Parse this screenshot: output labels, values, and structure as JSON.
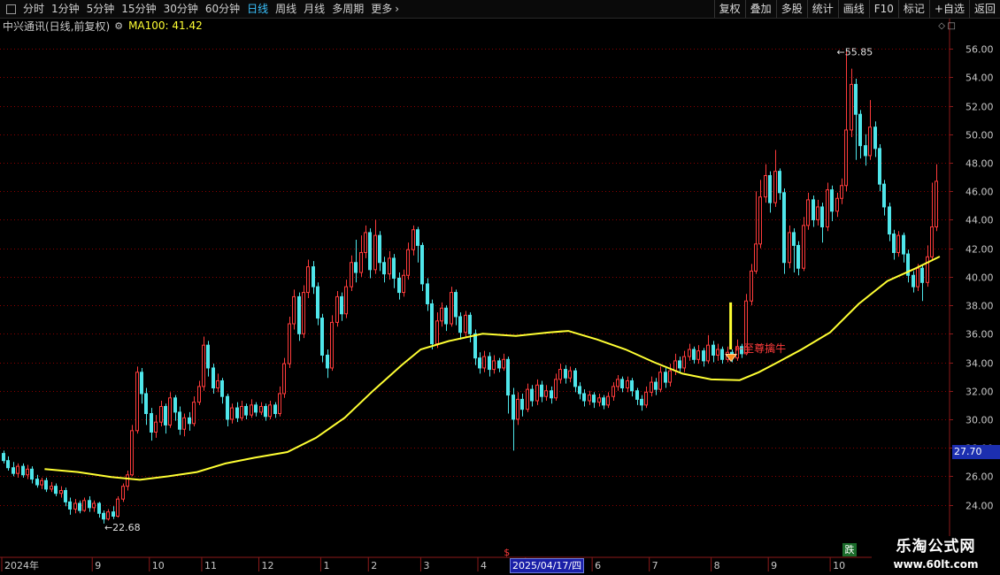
{
  "toolbar": {
    "periods": [
      "分时",
      "1分钟",
      "5分钟",
      "15分钟",
      "30分钟",
      "60分钟",
      "日线",
      "周线",
      "月线",
      "多周期",
      "更多"
    ],
    "active_period": "日线",
    "more_arrow": "›",
    "actions": [
      "复权",
      "叠加",
      "多股",
      "统计",
      "画线",
      "F10",
      "标记",
      "+自选",
      "返回"
    ]
  },
  "info": {
    "title": "中兴通讯(日线,前复权)",
    "ma_label": "MA100: 41.42",
    "diamond": "◇",
    "corner": "□"
  },
  "overlay": {
    "current_price_box": "27.70",
    "down_badge": "跌",
    "cursor_date": "2025/04/17/四",
    "cursor_marker": "$",
    "watermark_name": "乐淘公式网",
    "watermark_url": "www.60lt.com"
  },
  "colors": {
    "up": "#ff3b3b",
    "down": "#4fe6ea",
    "ma": "#ffff33",
    "grid": "#8b0000",
    "axis_text": "#c8c8c8",
    "annotation": "#ff3b3b",
    "signal_bar": "#ffff33",
    "signal_diamond": "#ff8c1a"
  },
  "chart_data": {
    "type": "candlestick",
    "ylim": [
      22.3,
      57.0
    ],
    "y_ticks": [
      24.0,
      26.0,
      28.0,
      30.0,
      32.0,
      34.0,
      36.0,
      38.0,
      40.0,
      42.0,
      44.0,
      46.0,
      48.0,
      50.0,
      52.0,
      54.0,
      56.0
    ],
    "x_labels": [
      {
        "label": "2024年",
        "bar": 0
      },
      {
        "label": "9",
        "bar": 19
      },
      {
        "label": "10",
        "bar": 31
      },
      {
        "label": "11",
        "bar": 42
      },
      {
        "label": "12",
        "bar": 54
      },
      {
        "label": "1",
        "bar": 67
      },
      {
        "label": "2",
        "bar": 77
      },
      {
        "label": "3",
        "bar": 88
      },
      {
        "label": "4",
        "bar": 100
      },
      {
        "label": "5",
        "bar": 110
      },
      {
        "label": "6",
        "bar": 124
      },
      {
        "label": "7",
        "bar": 136
      },
      {
        "label": "8",
        "bar": 149
      },
      {
        "label": "9",
        "bar": 161
      },
      {
        "label": "10",
        "bar": 174
      }
    ],
    "cursor_bar": 106,
    "ma_series": {
      "name": "MA100",
      "start_bar": 9,
      "points": [
        [
          9,
          26.5
        ],
        [
          16,
          26.3
        ],
        [
          23,
          25.95
        ],
        [
          29,
          25.75
        ],
        [
          35,
          26.0
        ],
        [
          41,
          26.3
        ],
        [
          47,
          26.9
        ],
        [
          53,
          27.3
        ],
        [
          60,
          27.7
        ],
        [
          66,
          28.7
        ],
        [
          72,
          30.1
        ],
        [
          78,
          32.0
        ],
        [
          84,
          33.8
        ],
        [
          88,
          34.9
        ],
        [
          94,
          35.5
        ],
        [
          101,
          36.0
        ],
        [
          108,
          35.85
        ],
        [
          115,
          36.1
        ],
        [
          119,
          36.2
        ],
        [
          125,
          35.6
        ],
        [
          131,
          34.9
        ],
        [
          137,
          34.0
        ],
        [
          143,
          33.2
        ],
        [
          149,
          32.8
        ],
        [
          155,
          32.75
        ],
        [
          159,
          33.3
        ],
        [
          163,
          34.0
        ],
        [
          168,
          34.9
        ],
        [
          174,
          36.1
        ],
        [
          180,
          38.1
        ],
        [
          186,
          39.7
        ],
        [
          192,
          40.6
        ],
        [
          197,
          41.42
        ]
      ]
    },
    "candles": [
      [
        27.6,
        27.1,
        27.8,
        26.9
      ],
      [
        27.1,
        26.6,
        27.4,
        26.4
      ],
      [
        26.6,
        26.2,
        27.0,
        26.0
      ],
      [
        26.2,
        26.7,
        26.9,
        25.9
      ],
      [
        26.7,
        26.1,
        26.9,
        25.9
      ],
      [
        26.1,
        26.5,
        26.8,
        25.8
      ],
      [
        26.5,
        25.8,
        26.7,
        25.5
      ],
      [
        25.8,
        25.4,
        26.1,
        25.2
      ],
      [
        25.4,
        25.7,
        25.9,
        25.1
      ],
      [
        25.7,
        25.1,
        25.9,
        24.9
      ],
      [
        25.1,
        25.3,
        25.6,
        24.9
      ],
      [
        25.3,
        24.8,
        25.5,
        24.6
      ],
      [
        24.8,
        25.0,
        25.3,
        24.5
      ],
      [
        25.0,
        24.2,
        25.2,
        23.9
      ],
      [
        24.2,
        23.7,
        24.5,
        23.3
      ],
      [
        23.7,
        24.1,
        24.4,
        23.4
      ],
      [
        24.1,
        23.6,
        24.3,
        23.4
      ],
      [
        23.6,
        24.3,
        24.5,
        23.5
      ],
      [
        24.3,
        23.8,
        24.6,
        23.5
      ],
      [
        23.8,
        24.1,
        24.3,
        23.5
      ],
      [
        24.1,
        23.4,
        24.2,
        23.1
      ],
      [
        23.4,
        23.0,
        23.6,
        22.68
      ],
      [
        23.0,
        23.5,
        23.7,
        22.9
      ],
      [
        23.5,
        23.2,
        23.9,
        23.0
      ],
      [
        23.2,
        24.4,
        24.6,
        23.1
      ],
      [
        24.4,
        25.3,
        25.5,
        24.2
      ],
      [
        25.3,
        26.1,
        26.4,
        25.0
      ],
      [
        26.1,
        29.2,
        29.6,
        26.0
      ],
      [
        29.2,
        33.3,
        33.7,
        29.0
      ],
      [
        33.3,
        31.8,
        33.6,
        31.1
      ],
      [
        31.8,
        30.4,
        32.2,
        29.6
      ],
      [
        30.4,
        29.1,
        30.8,
        28.5
      ],
      [
        29.1,
        29.8,
        30.3,
        28.7
      ],
      [
        29.8,
        30.9,
        31.3,
        29.5
      ],
      [
        30.9,
        29.6,
        31.1,
        29.0
      ],
      [
        29.6,
        31.5,
        31.9,
        29.4
      ],
      [
        31.5,
        30.5,
        31.7,
        29.9
      ],
      [
        30.5,
        29.3,
        30.9,
        28.9
      ],
      [
        29.3,
        30.1,
        30.4,
        28.8
      ],
      [
        30.1,
        29.7,
        30.5,
        29.2
      ],
      [
        29.7,
        31.2,
        31.6,
        29.5
      ],
      [
        31.2,
        32.3,
        32.7,
        31.0
      ],
      [
        32.3,
        35.2,
        35.8,
        32.0
      ],
      [
        35.2,
        33.6,
        35.5,
        33.0
      ],
      [
        33.6,
        32.2,
        33.9,
        31.8
      ],
      [
        32.2,
        32.7,
        33.2,
        31.9
      ],
      [
        32.7,
        31.6,
        32.9,
        31.1
      ],
      [
        31.6,
        30.0,
        31.8,
        29.5
      ],
      [
        30.0,
        30.8,
        31.1,
        29.7
      ],
      [
        30.8,
        30.1,
        31.2,
        29.8
      ],
      [
        30.1,
        30.9,
        31.3,
        29.9
      ],
      [
        30.9,
        30.3,
        31.1,
        30.0
      ],
      [
        30.3,
        31.0,
        31.4,
        30.1
      ],
      [
        31.0,
        30.5,
        31.2,
        30.2
      ],
      [
        30.5,
        30.9,
        31.2,
        30.3
      ],
      [
        30.9,
        30.2,
        31.1,
        29.9
      ],
      [
        30.2,
        31.0,
        31.3,
        30.0
      ],
      [
        31.0,
        30.4,
        31.2,
        30.1
      ],
      [
        30.4,
        31.8,
        32.3,
        30.2
      ],
      [
        31.8,
        33.9,
        34.3,
        31.5
      ],
      [
        33.9,
        36.7,
        37.2,
        33.6
      ],
      [
        36.7,
        38.6,
        39.1,
        36.3
      ],
      [
        38.6,
        36.0,
        38.9,
        35.5
      ],
      [
        36.0,
        38.9,
        39.4,
        35.7
      ],
      [
        38.9,
        40.7,
        41.2,
        38.5
      ],
      [
        40.7,
        39.3,
        41.1,
        38.8
      ],
      [
        39.3,
        37.1,
        39.6,
        36.6
      ],
      [
        37.1,
        34.5,
        37.4,
        34.0
      ],
      [
        34.5,
        33.6,
        34.9,
        32.9
      ],
      [
        33.6,
        36.8,
        37.3,
        33.4
      ],
      [
        36.8,
        38.6,
        39.0,
        36.5
      ],
      [
        38.6,
        37.4,
        38.9,
        36.9
      ],
      [
        37.4,
        39.3,
        39.8,
        37.1
      ],
      [
        39.3,
        41.0,
        41.5,
        39.0
      ],
      [
        41.0,
        40.3,
        42.6,
        39.6
      ],
      [
        40.3,
        41.7,
        42.9,
        40.0
      ],
      [
        41.7,
        43.1,
        43.6,
        41.3
      ],
      [
        43.1,
        40.5,
        43.4,
        39.9
      ],
      [
        40.5,
        42.9,
        44.0,
        40.2
      ],
      [
        42.9,
        41.0,
        43.2,
        40.4
      ],
      [
        41.0,
        40.2,
        41.4,
        39.6
      ],
      [
        40.2,
        41.3,
        41.8,
        39.8
      ],
      [
        41.3,
        39.9,
        41.6,
        39.2
      ],
      [
        39.9,
        38.9,
        40.3,
        38.4
      ],
      [
        38.9,
        40.1,
        40.5,
        38.6
      ],
      [
        40.1,
        41.9,
        42.4,
        39.8
      ],
      [
        41.9,
        43.3,
        43.6,
        41.5
      ],
      [
        43.3,
        42.2,
        43.5,
        41.0
      ],
      [
        42.2,
        39.5,
        42.4,
        39.0
      ],
      [
        39.5,
        38.1,
        39.9,
        37.6
      ],
      [
        38.1,
        35.3,
        38.4,
        34.9
      ],
      [
        35.3,
        36.9,
        37.5,
        35.0
      ],
      [
        36.9,
        37.8,
        38.2,
        36.5
      ],
      [
        37.8,
        36.7,
        38.0,
        36.2
      ],
      [
        36.7,
        38.9,
        39.3,
        36.5
      ],
      [
        38.9,
        37.2,
        39.1,
        36.6
      ],
      [
        37.2,
        36.1,
        37.5,
        35.6
      ],
      [
        36.1,
        37.3,
        37.6,
        35.8
      ],
      [
        37.3,
        36.0,
        37.5,
        35.4
      ],
      [
        36.0,
        34.3,
        36.3,
        33.8
      ],
      [
        34.3,
        33.6,
        34.7,
        33.2
      ],
      [
        33.6,
        34.4,
        34.8,
        33.3
      ],
      [
        34.4,
        33.5,
        34.7,
        33.0
      ],
      [
        33.5,
        34.1,
        34.5,
        33.2
      ],
      [
        34.1,
        33.6,
        34.3,
        33.3
      ],
      [
        33.6,
        34.2,
        34.6,
        33.4
      ],
      [
        34.2,
        31.7,
        34.4,
        30.4
      ],
      [
        31.7,
        30.0,
        32.2,
        27.8
      ],
      [
        30.0,
        31.4,
        31.9,
        29.6
      ],
      [
        31.4,
        30.7,
        31.8,
        30.2
      ],
      [
        30.7,
        32.1,
        32.5,
        30.5
      ],
      [
        32.1,
        31.3,
        32.4,
        30.9
      ],
      [
        31.3,
        32.4,
        32.8,
        31.0
      ],
      [
        32.4,
        31.6,
        32.7,
        31.2
      ],
      [
        31.6,
        32.0,
        32.4,
        31.3
      ],
      [
        32.0,
        31.5,
        32.3,
        31.1
      ],
      [
        31.5,
        32.8,
        33.2,
        31.3
      ],
      [
        32.8,
        33.5,
        33.9,
        32.5
      ],
      [
        33.5,
        32.9,
        33.8,
        32.5
      ],
      [
        32.9,
        33.4,
        33.7,
        32.6
      ],
      [
        33.4,
        32.3,
        33.6,
        31.9
      ],
      [
        32.3,
        31.8,
        32.6,
        31.4
      ],
      [
        31.8,
        31.3,
        32.1,
        30.9
      ],
      [
        31.3,
        31.7,
        32.0,
        31.0
      ],
      [
        31.7,
        31.2,
        31.9,
        30.8
      ],
      [
        31.2,
        31.5,
        31.8,
        30.9
      ],
      [
        31.5,
        31.0,
        31.7,
        30.7
      ],
      [
        31.0,
        31.6,
        31.9,
        30.8
      ],
      [
        31.6,
        32.3,
        32.6,
        31.3
      ],
      [
        32.3,
        32.8,
        33.1,
        32.0
      ],
      [
        32.8,
        32.2,
        33.0,
        31.9
      ],
      [
        32.2,
        32.7,
        33.0,
        31.9
      ],
      [
        32.7,
        32.0,
        32.9,
        31.6
      ],
      [
        32.0,
        31.4,
        32.2,
        31.0
      ],
      [
        31.4,
        31.0,
        31.7,
        30.6
      ],
      [
        31.0,
        31.9,
        32.3,
        30.8
      ],
      [
        31.9,
        32.6,
        33.0,
        31.6
      ],
      [
        32.6,
        32.1,
        32.9,
        31.7
      ],
      [
        32.1,
        33.3,
        33.7,
        31.9
      ],
      [
        33.3,
        32.6,
        33.6,
        32.2
      ],
      [
        32.6,
        33.4,
        33.9,
        32.3
      ],
      [
        33.4,
        34.1,
        34.6,
        33.1
      ],
      [
        34.1,
        33.6,
        34.4,
        33.2
      ],
      [
        33.6,
        34.4,
        34.8,
        33.3
      ],
      [
        34.4,
        34.9,
        35.3,
        34.1
      ],
      [
        34.9,
        34.2,
        35.1,
        33.9
      ],
      [
        34.2,
        34.8,
        35.2,
        33.9
      ],
      [
        34.8,
        34.1,
        35.0,
        33.7
      ],
      [
        34.1,
        35.2,
        35.9,
        33.9
      ],
      [
        35.2,
        34.5,
        35.5,
        34.0
      ],
      [
        34.5,
        34.9,
        35.3,
        34.1
      ],
      [
        34.9,
        34.2,
        35.1,
        33.9
      ],
      [
        34.2,
        34.7,
        35.1,
        34.0
      ],
      [
        34.7,
        34.3,
        34.9,
        34.0
      ],
      [
        34.3,
        35.1,
        35.6,
        34.1
      ],
      [
        35.1,
        34.6,
        35.3,
        34.3
      ],
      [
        34.6,
        38.3,
        38.8,
        34.5
      ],
      [
        38.3,
        40.4,
        40.9,
        38.0
      ],
      [
        40.4,
        42.3,
        46.0,
        40.2
      ],
      [
        42.3,
        45.6,
        46.8,
        42.0
      ],
      [
        45.6,
        47.1,
        47.9,
        45.2
      ],
      [
        47.1,
        45.2,
        47.4,
        44.5
      ],
      [
        45.2,
        47.4,
        48.9,
        44.9
      ],
      [
        47.4,
        45.9,
        47.6,
        45.4
      ],
      [
        45.9,
        41.0,
        46.2,
        40.2
      ],
      [
        41.0,
        43.1,
        43.6,
        40.6
      ],
      [
        43.1,
        42.2,
        43.4,
        40.3
      ],
      [
        42.2,
        40.6,
        42.5,
        40.1
      ],
      [
        40.6,
        43.6,
        44.2,
        40.4
      ],
      [
        43.6,
        45.4,
        45.9,
        43.3
      ],
      [
        45.4,
        44.0,
        45.7,
        43.5
      ],
      [
        44.0,
        44.9,
        45.4,
        43.6
      ],
      [
        44.9,
        43.5,
        45.2,
        42.4
      ],
      [
        43.5,
        46.1,
        46.6,
        43.2
      ],
      [
        46.1,
        44.6,
        46.4,
        43.9
      ],
      [
        44.6,
        45.5,
        45.9,
        44.2
      ],
      [
        45.5,
        46.4,
        46.9,
        45.1
      ],
      [
        46.4,
        50.3,
        55.85,
        46.0
      ],
      [
        50.3,
        53.5,
        54.6,
        49.8
      ],
      [
        53.5,
        51.4,
        53.9,
        48.2
      ],
      [
        51.4,
        49.2,
        51.7,
        48.3
      ],
      [
        49.2,
        48.5,
        50.0,
        47.8
      ],
      [
        48.5,
        50.5,
        52.4,
        48.2
      ],
      [
        50.5,
        49.0,
        50.9,
        48.4
      ],
      [
        49.0,
        46.5,
        49.3,
        46.0
      ],
      [
        46.5,
        44.9,
        46.8,
        44.3
      ],
      [
        44.9,
        43.0,
        45.2,
        42.5
      ],
      [
        43.0,
        41.7,
        43.3,
        41.2
      ],
      [
        41.7,
        42.9,
        43.2,
        41.4
      ],
      [
        42.9,
        41.6,
        43.1,
        41.0
      ],
      [
        41.6,
        40.1,
        41.9,
        39.6
      ],
      [
        40.1,
        39.3,
        40.4,
        38.9
      ],
      [
        39.3,
        40.6,
        40.9,
        39.0
      ],
      [
        40.6,
        39.6,
        40.8,
        38.3
      ],
      [
        39.6,
        41.4,
        42.2,
        39.3
      ],
      [
        41.4,
        43.5,
        46.6,
        41.1
      ],
      [
        43.5,
        46.7,
        47.9,
        43.2
      ]
    ],
    "annotations": [
      {
        "type": "low",
        "bar": 21,
        "price": 22.68,
        "text": "←22.68"
      },
      {
        "type": "high",
        "bar": 175,
        "price": 55.85,
        "text": "←55.85"
      },
      {
        "type": "signal",
        "bar": 153,
        "price": 34.5,
        "bar_from": 34.9,
        "bar_to": 38.2,
        "text": "←至尊擒牛"
      }
    ]
  }
}
